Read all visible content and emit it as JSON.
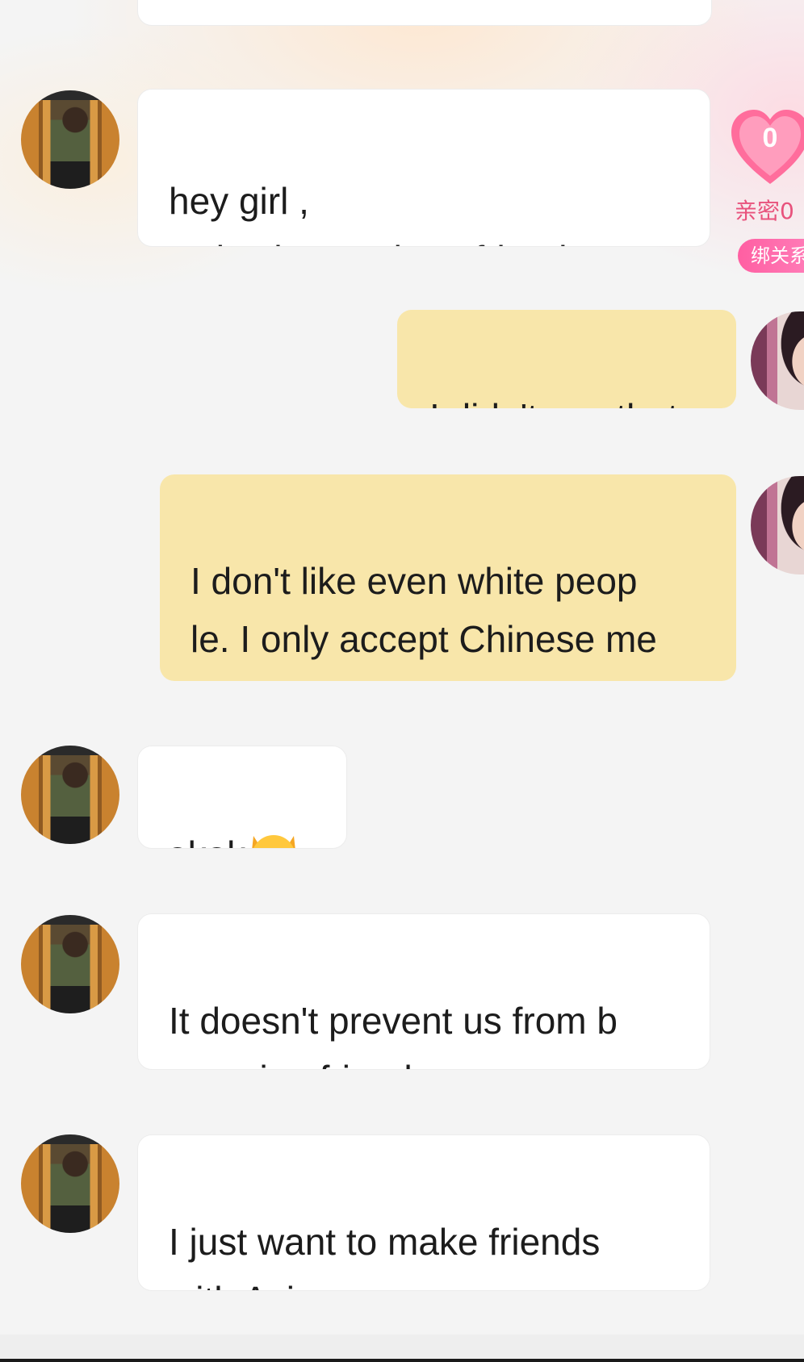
{
  "intimacy_widget": {
    "heart_count": "0",
    "intimacy_label": "亲密0",
    "bind_button_label": "绑关系",
    "heart_color": "#ff6d9c"
  },
  "messages": [
    {
      "sender": "other",
      "text": "hey girl  ,\nRelax  just make a friend"
    },
    {
      "sender": "self",
      "text": "I didn't say that"
    },
    {
      "sender": "self",
      "text": "I don't like even white peop\nle. I only accept Chinese me\nn"
    },
    {
      "sender": "other",
      "text": "okok",
      "emoji": "laughing-cat-emoji"
    },
    {
      "sender": "other",
      "text": "It doesn't prevent us from b\necoming friends"
    },
    {
      "sender": "other",
      "text": "I just want to make friends\nwith Asian women"
    }
  ],
  "colors": {
    "incoming_bubble": "#ffffff",
    "outgoing_bubble": "#f8e6aa",
    "background": "#f4f4f4",
    "accent_pink": "#ff5fa2"
  }
}
